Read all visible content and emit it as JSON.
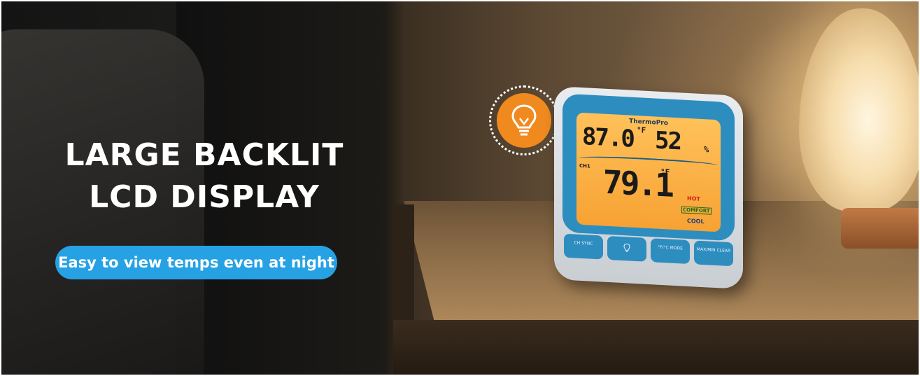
{
  "banner": {
    "headline_line1": "LARGE BACKLIT",
    "headline_line2": "LCD DISPLAY",
    "tagline": "Easy to view temps even at night"
  },
  "badge": {
    "icon": "light-bulb-icon",
    "color": "#f08a1e"
  },
  "device": {
    "brand": "ThermoPro",
    "indoor_temp": "87.0",
    "indoor_unit": "°F",
    "humidity": "52",
    "humidity_unit": "%",
    "channel": "CH1",
    "outdoor_temp": "79.1",
    "outdoor_unit": "°F",
    "comfort_levels": [
      "HOT",
      "COMFORT",
      "COOL"
    ],
    "buttons": [
      "CH SYNC",
      "",
      "°F/°C MODE",
      "MAX/MIN CLEAR"
    ],
    "button_icons": [
      "",
      "light-bulb-icon",
      "",
      ""
    ]
  },
  "colors": {
    "pill": "#26a2e4",
    "device_blue": "#2e8dbf",
    "lcd": "#f7a233"
  }
}
